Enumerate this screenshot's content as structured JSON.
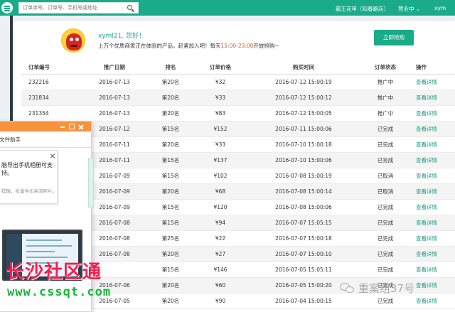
{
  "topbar": {
    "search_placeholder": "订单序号、订单号、手机号或地址",
    "shop_name": "霸王花甲（知春路店）",
    "status_label": "营业中",
    "user_label": "xym"
  },
  "promo": {
    "greeting": "xyml21, 您好！",
    "text_before": "上万个优质商家正在体验的产品，赶紧加入吧！每天",
    "time_range": "15:00-23:00",
    "text_after": "开放抢购~",
    "buy_button": "立即抢购"
  },
  "table": {
    "headers": [
      "订单编号",
      "推广日期",
      "排名",
      "订单价格",
      "购买时间",
      "订单状态",
      "操作"
    ],
    "rows": [
      {
        "id": "232216",
        "date": "2016-07-13",
        "rank": "第20名",
        "price": "¥32",
        "time": "2016-07-12 15:00:19",
        "status": "推广中",
        "action": "查看详情"
      },
      {
        "id": "231834",
        "date": "2016-07-13",
        "rank": "第20名",
        "price": "¥33",
        "time": "2016-07-12 15:00:12",
        "status": "推广中",
        "action": "查看详情"
      },
      {
        "id": "231354",
        "date": "2016-07-13",
        "rank": "第20名",
        "price": "¥83",
        "time": "2016-07-12 15:00:05",
        "status": "推广中",
        "action": "查看详情"
      },
      {
        "id": "",
        "date": "2016-07-12",
        "rank": "第15名",
        "price": "¥152",
        "time": "2016-07-11 15:00:06",
        "status": "已完成",
        "action": "查看详情"
      },
      {
        "id": "",
        "date": "2016-07-11",
        "rank": "第20名",
        "price": "¥33",
        "time": "2016-07-10 15:00:18",
        "status": "已完成",
        "action": "查看详情"
      },
      {
        "id": "",
        "date": "2016-07-11",
        "rank": "第15名",
        "price": "¥137",
        "time": "2016-07-10 15:00:06",
        "status": "已完成",
        "action": "查看详情"
      },
      {
        "id": "",
        "date": "2016-07-09",
        "rank": "第15名",
        "price": "¥102",
        "time": "2016-07-08 15:00:19",
        "status": "已取消",
        "action": "查看详情"
      },
      {
        "id": "",
        "date": "2016-07-09",
        "rank": "第20名",
        "price": "¥68",
        "time": "2016-07-08 15:00:14",
        "status": "已取消",
        "action": "查看详情"
      },
      {
        "id": "",
        "date": "2016-07-09",
        "rank": "第15名",
        "price": "¥120",
        "time": "2016-07-08 15:00:06",
        "status": "已完成",
        "action": "查看详情"
      },
      {
        "id": "",
        "date": "2016-07-08",
        "rank": "第15名",
        "price": "¥94",
        "time": "2016-07-07 15:05:15",
        "status": "已完成",
        "action": "查看详情"
      },
      {
        "id": "",
        "date": "2016-07-08",
        "rank": "第25名",
        "price": "¥22",
        "time": "2016-07-07 15:00:18",
        "status": "已完成",
        "action": "查看详情"
      },
      {
        "id": "",
        "date": "2016-07-08",
        "rank": "第20名",
        "price": "¥27",
        "time": "2016-07-07 15:00:10",
        "status": "已完成",
        "action": "查看详情"
      },
      {
        "id": "",
        "date": "",
        "rank": "第15名",
        "price": "¥146",
        "time": "2016-07-05 15:05:11",
        "status": "已完成",
        "action": "查看详情"
      },
      {
        "id": "",
        "date": "2016-07-06",
        "rank": "第20名",
        "price": "¥60",
        "time": "2016-07-05 15:00:20",
        "status": "已完成",
        "action": "查看详情"
      },
      {
        "id": "",
        "date": "2016-07-05",
        "rank": "第20名",
        "price": "¥90",
        "time": "2016-07-04 15:00:15",
        "status": "已完成",
        "action": "查看详情"
      }
    ]
  },
  "popup": {
    "title": "文件助手",
    "tip_text": "脑导出手机相册可支持。",
    "tip_sub": "提醒，批量导出高清照片。"
  },
  "watermarks": {
    "site_cn": "长沙社区通",
    "site_url": "www.cssqt.com",
    "account": "重案组37号"
  },
  "colors": {
    "brand": "#1aab8a",
    "highlight": "#e65a2f",
    "popup_bar": "#f7933c"
  }
}
